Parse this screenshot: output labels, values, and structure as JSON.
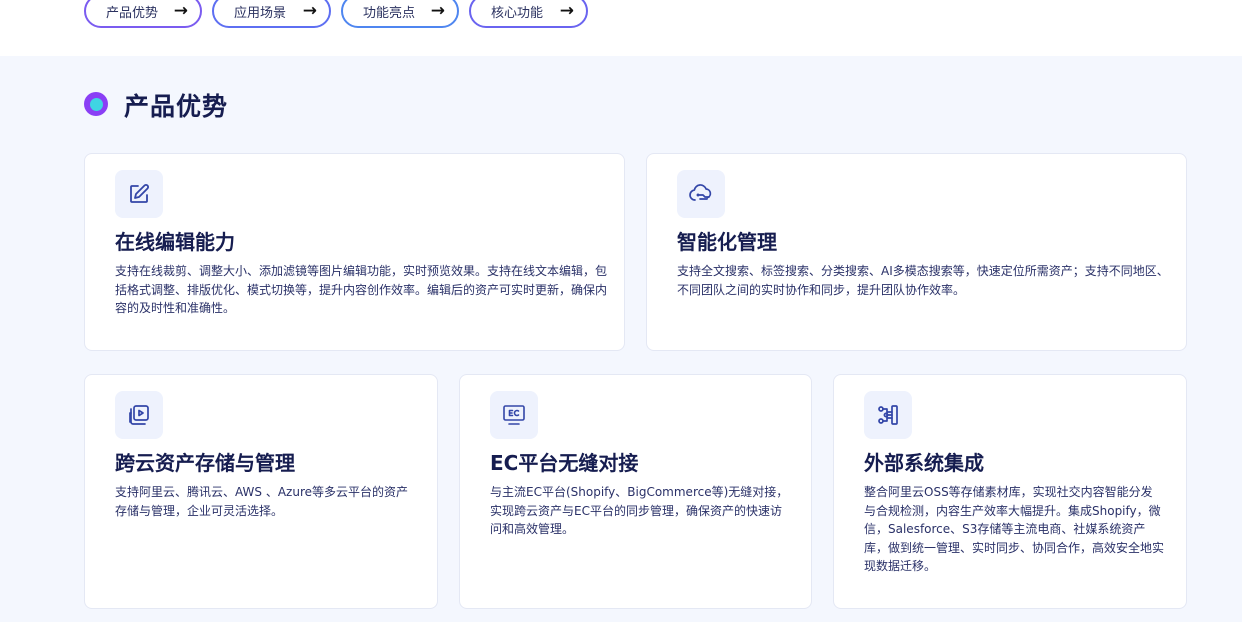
{
  "nav": {
    "pills": [
      {
        "label": "产品优势",
        "arrow": "→"
      },
      {
        "label": "应用场景",
        "arrow": "→"
      },
      {
        "label": "功能亮点",
        "arrow": "→"
      },
      {
        "label": "核心功能",
        "arrow": "→"
      }
    ]
  },
  "section": {
    "title": "产品优势"
  },
  "cards": [
    {
      "icon": "edit-icon",
      "title": "在线编辑能力",
      "desc": "支持在线裁剪、调整大小、添加滤镜等图片编辑功能，实时预览效果。支持在线文本编辑，包括格式调整、排版优化、模式切换等，提升内容创作效率。编辑后的资产可实时更新，确保内容的及时性和准确性。"
    },
    {
      "icon": "cloud-brain-icon",
      "title": "智能化管理",
      "desc": "支持全文搜索、标签搜索、分类搜索、AI多模态搜索等，快速定位所需资产；支持不同地区、不同团队之间的实时协作和同步，提升团队协作效率。"
    },
    {
      "icon": "media-library-icon",
      "title": "跨云资产存储与管理",
      "desc": "支持阿里云、腾讯云、AWS 、Azure等多云平台的资产存储与管理，企业可灵活选择。"
    },
    {
      "icon": "ec-monitor-icon",
      "title": "EC平台无缝对接",
      "desc": "与主流EC平台(Shopify、BigCommerce等)无缝对接，实现跨云资产与EC平台的同步管理，确保资产的快速访问和高效管理。"
    },
    {
      "icon": "integration-icon",
      "title": "外部系统集成",
      "desc": "整合阿里云OSS等存储素材库，实现社交内容智能分发与合规检测，内容生产效率大幅提升。集成Shopify，微信，Salesforce、S3存储等主流电商、社媒系统资产库，做到统一管理、实时同步、协同合作，高效安全地实现数据迁移。"
    }
  ],
  "colors": {
    "accent": "#5b7cf5",
    "title": "#161d50",
    "dot_outer": "#8a3ff5",
    "dot_inner": "#3fd5e3",
    "icon": "#3346a8"
  }
}
